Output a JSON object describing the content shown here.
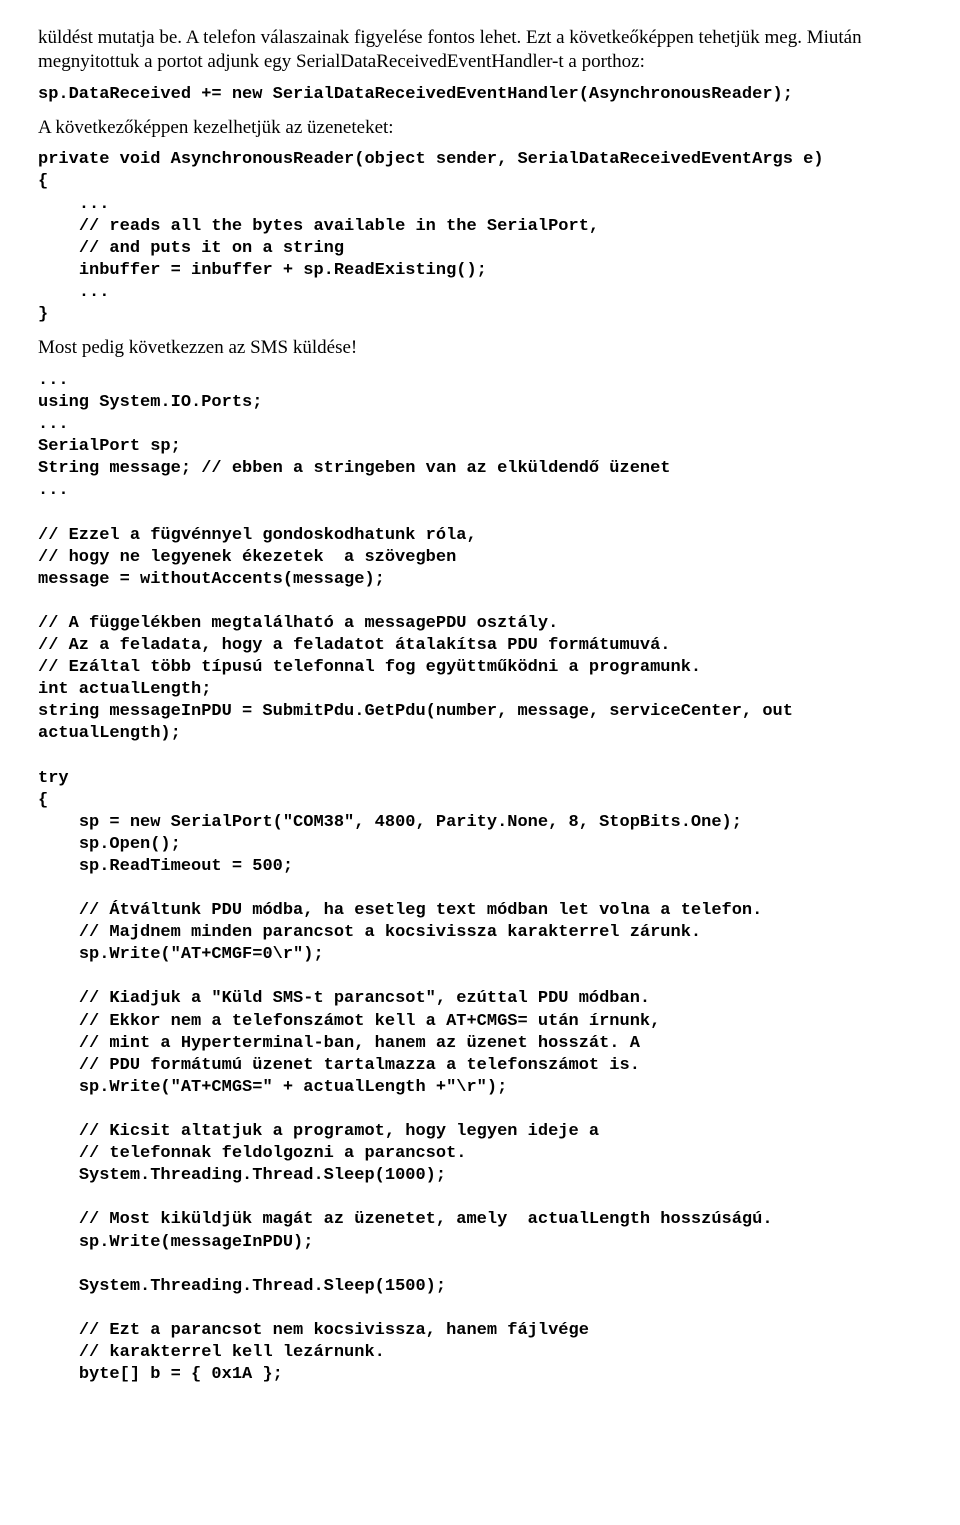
{
  "p1": "küldést mutatja be. A telefon válaszainak figyelése fontos lehet. Ezt a követkeőképpen tehetjük meg. Miután megnyitottuk a portot adjunk egy  SerialDataReceivedEventHandler-t a porthoz:",
  "code1": "sp.DataReceived += new SerialDataReceivedEventHandler(AsynchronousReader);",
  "p2": "A következőképpen kezelhetjük az üzeneteket:",
  "code2": "private void AsynchronousReader(object sender, SerialDataReceivedEventArgs e)\n{\n    ...\n    // reads all the bytes available in the SerialPort,\n    // and puts it on a string\n    inbuffer = inbuffer + sp.ReadExisting();\n    ...\n}",
  "p3": "Most pedig következzen az SMS küldése!",
  "code3": "...\nusing System.IO.Ports;\n...\nSerialPort sp;\nString message; // ebben a stringeben van az elküldendő üzenet\n...\n\n// Ezzel a fügvénnyel gondoskodhatunk róla,\n// hogy ne legyenek ékezetek  a szövegben\nmessage = withoutAccents(message);\n\n// A függelékben megtalálható a messagePDU osztály.\n// Az a feladata, hogy a feladatot átalakítsa PDU formátumuvá.\n// Ezáltal több típusú telefonnal fog együttműködni a programunk.\nint actualLength;\nstring messageInPDU = SubmitPdu.GetPdu(number, message, serviceCenter, out actualLength);\n\ntry\n{\n    sp = new SerialPort(\"COM38\", 4800, Parity.None, 8, StopBits.One);\n    sp.Open();\n    sp.ReadTimeout = 500;\n\n    // Átváltunk PDU módba, ha esetleg text módban let volna a telefon.\n    // Majdnem minden parancsot a kocsivissza karakterrel zárunk.\n    sp.Write(\"AT+CMGF=0\\r\");\n\n    // Kiadjuk a \"Küld SMS-t parancsot\", ezúttal PDU módban.\n    // Ekkor nem a telefonszámot kell a AT+CMGS= után írnunk,\n    // mint a Hyperterminal-ban, hanem az üzenet hosszát. A\n    // PDU formátumú üzenet tartalmazza a telefonszámot is.\n    sp.Write(\"AT+CMGS=\" + actualLength +\"\\r\");\n\n    // Kicsit altatjuk a programot, hogy legyen ideje a\n    // telefonnak feldolgozni a parancsot.\n    System.Threading.Thread.Sleep(1000);\n\n    // Most kiküldjük magát az üzenetet, amely  actualLength hosszúságú.\n    sp.Write(messageInPDU);\n\n    System.Threading.Thread.Sleep(1500);\n\n    // Ezt a parancsot nem kocsivissza, hanem fájlvége\n    // karakterrel kell lezárnunk.\n    byte[] b = { 0x1A };"
}
